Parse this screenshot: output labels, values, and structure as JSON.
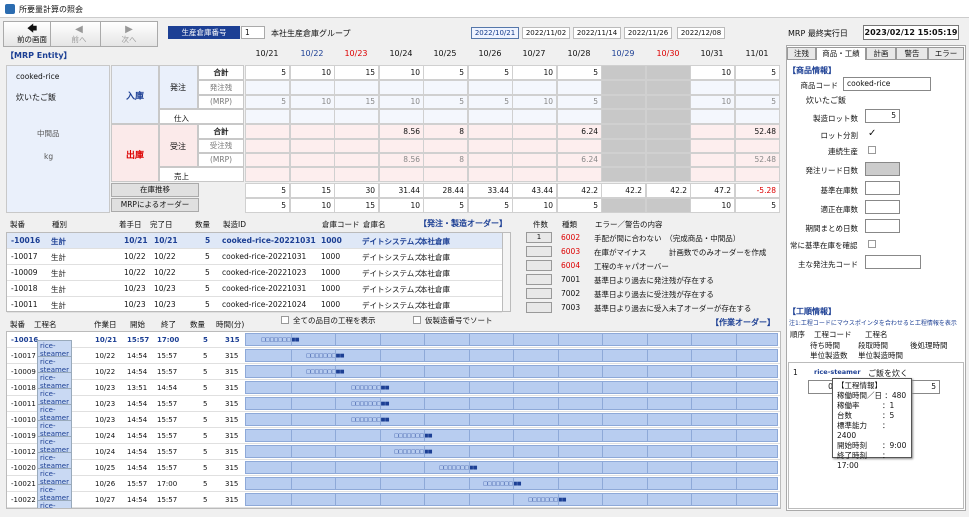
{
  "window": {
    "title": "所要量計算の照会"
  },
  "nav": {
    "prev_screen": "前の画面",
    "prev": "前へ",
    "next": "次へ"
  },
  "production": {
    "label": "生産倉庫番号",
    "value": "1",
    "name": "本社生産倉庫グループ"
  },
  "date_tabs": [
    "2022/10/21",
    "2022/11/02",
    "2022/11/14",
    "2022/11/26",
    "2022/12/08"
  ],
  "mrp": {
    "label": "MRP 最終実行日",
    "value": "2023/02/12 15:05:19"
  },
  "entity": {
    "title": "【MRP Entity】",
    "item_code": "cooked-rice",
    "item_name": "炊いたご飯",
    "category": "中間品",
    "unit": "kg"
  },
  "grid_dates": [
    {
      "d": "10/21",
      "c": "k"
    },
    {
      "d": "10/22",
      "c": "b"
    },
    {
      "d": "10/23",
      "c": "r"
    },
    {
      "d": "10/24",
      "c": "k"
    },
    {
      "d": "10/25",
      "c": "k"
    },
    {
      "d": "10/26",
      "c": "k"
    },
    {
      "d": "10/27",
      "c": "k"
    },
    {
      "d": "10/28",
      "c": "k"
    },
    {
      "d": "10/29",
      "c": "b"
    },
    {
      "d": "10/30",
      "c": "r"
    },
    {
      "d": "10/31",
      "c": "k"
    },
    {
      "d": "11/01",
      "c": "k"
    }
  ],
  "labels": {
    "nyuko": "入庫",
    "hatchu": "発注",
    "shiire": "仕入",
    "shukko": "出庫",
    "juchu": "受注",
    "uriage": "売上",
    "total": "合計",
    "hatchu_zan": "発注残",
    "juchu_zan": "受注残",
    "mrp": "(MRP)",
    "zaiko": "在庫推移",
    "mrp_order": "MRPによるオーダー"
  },
  "rows": {
    "in_total": [
      "5",
      "10",
      "15",
      "10",
      "5",
      "5",
      "10",
      "5",
      "",
      "",
      "10",
      "5"
    ],
    "in_mrp": [
      "5",
      "10",
      "15",
      "10",
      "5",
      "5",
      "10",
      "5",
      "",
      "",
      "10",
      "5"
    ],
    "out_total": [
      "",
      "",
      "",
      "8.56",
      "8",
      "",
      "",
      "6.24",
      "",
      "",
      "",
      "52.48"
    ],
    "out_mrp": [
      "",
      "",
      "",
      "8.56",
      "8",
      "",
      "",
      "6.24",
      "",
      "",
      "",
      "52.48"
    ],
    "zaiko": [
      "5",
      "15",
      "30",
      "31.44",
      "28.44",
      "33.44",
      "43.44",
      "42.2",
      "42.2",
      "42.2",
      "47.2",
      "-5.28"
    ],
    "mrp_order": [
      "5",
      "10",
      "15",
      "10",
      "5",
      "5",
      "10",
      "5",
      "",
      "",
      "10",
      "5"
    ]
  },
  "orders": {
    "headers": [
      "製番",
      "種別",
      "着手日",
      "完了日",
      "数量",
      "製造ID",
      "倉庫コード",
      "倉庫名"
    ],
    "title": "【発注・製造オーダー】",
    "rows": [
      [
        "-10016",
        "生計",
        "10/21",
        "10/21",
        "5",
        "cooked-rice-20221031",
        "1000",
        "デイトシステムズ",
        "本社倉庫"
      ],
      [
        "-10017",
        "生計",
        "10/22",
        "10/22",
        "5",
        "cooked-rice-20221031",
        "1000",
        "デイトシステムズ",
        "本社倉庫"
      ],
      [
        "-10009",
        "生計",
        "10/22",
        "10/22",
        "5",
        "cooked-rice-20221023",
        "1000",
        "デイトシステムズ",
        "本社倉庫"
      ],
      [
        "-10018",
        "生計",
        "10/23",
        "10/23",
        "5",
        "cooked-rice-20221031",
        "1000",
        "デイトシステムズ",
        "本社倉庫"
      ],
      [
        "-10011",
        "生計",
        "10/23",
        "10/23",
        "5",
        "cooked-rice-20221024",
        "1000",
        "デイトシステムズ",
        "本社倉庫"
      ]
    ]
  },
  "errors": {
    "headers": [
      "件数",
      "種類",
      "エラー／警告の内容"
    ],
    "rows": [
      {
        "count": "1",
        "code": "6002",
        "msg": "手配が間に合わない　（完成商品・中間品）",
        "red": true
      },
      {
        "count": "",
        "code": "6003",
        "msg": "在庫がマイナス　　　計画数でのみオーダーを作成",
        "red": true
      },
      {
        "count": "",
        "code": "6004",
        "msg": "工程のキャパオーバー",
        "red": true
      },
      {
        "count": "",
        "code": "7001",
        "msg": "基準日より過去に発注残が存在する",
        "red": false
      },
      {
        "count": "",
        "code": "7002",
        "msg": "基準日より過去に受注残が存在する",
        "red": false
      },
      {
        "count": "",
        "code": "7003",
        "msg": "基準日より過去に受入未了オーダーが存在する",
        "red": false
      }
    ]
  },
  "checks": {
    "all_process": "全ての品目の工程を表示",
    "temp_sort": "仮製造番号でソート"
  },
  "process": {
    "headers": [
      "製番",
      "工程名",
      "作業日",
      "開始",
      "終了",
      "数量",
      "時間(分)"
    ],
    "title": "【作業オーダー】",
    "rows": [
      [
        "-10016",
        "rice-steamer",
        "10/21",
        "15:57",
        "17:00",
        "5",
        "315"
      ],
      [
        "-10017",
        "rice-steamer",
        "10/22",
        "14:54",
        "15:57",
        "5",
        "315"
      ],
      [
        "-10009",
        "rice-steamer",
        "10/22",
        "14:54",
        "15:57",
        "5",
        "315"
      ],
      [
        "-10018",
        "rice-steamer",
        "10/23",
        "13:51",
        "14:54",
        "5",
        "315"
      ],
      [
        "-10011",
        "rice-steamer",
        "10/23",
        "14:54",
        "15:57",
        "5",
        "315"
      ],
      [
        "-10010",
        "rice-steamer",
        "10/23",
        "14:54",
        "15:57",
        "5",
        "315"
      ],
      [
        "-10019",
        "rice-steamer",
        "10/24",
        "14:54",
        "15:57",
        "5",
        "315"
      ],
      [
        "-10012",
        "rice-steamer",
        "10/24",
        "14:54",
        "15:57",
        "5",
        "315"
      ],
      [
        "-10020",
        "rice-steamer",
        "10/25",
        "14:54",
        "15:57",
        "5",
        "315"
      ],
      [
        "-10021",
        "rice-steamer",
        "10/26",
        "15:57",
        "17:00",
        "5",
        "315"
      ],
      [
        "-10022",
        "rice-steamer",
        "10/27",
        "14:54",
        "15:57",
        "5",
        "315"
      ]
    ]
  },
  "right_tabs": [
    "注残",
    "商品・工績",
    "計画",
    "警告",
    "エラー"
  ],
  "item_info": {
    "title": "【商品情報】",
    "code_label": "商品コード",
    "code": "cooked-rice",
    "name": "炊いたご飯",
    "lot_label": "製造ロット数",
    "lot": "5",
    "split_label": "ロット分割",
    "cont_label": "連続生産",
    "lead_label": "発注リード日数",
    "base_label": "基準在庫数",
    "proper_label": "適正在庫数",
    "period_label": "期間まとめ日数",
    "always_label": "常に基準在庫を確認",
    "supplier_label": "主な発注先コード"
  },
  "proc_info": {
    "title": "【工順情報】",
    "note": "注1:工程コードにマウスポインタを合わせると工程情報を表示",
    "h1": "順序",
    "h2": "工程コード",
    "h3": "工程名",
    "h4": "待ち時間",
    "h5": "段取時間",
    "h6": "後処理時間",
    "h7": "単位製造数",
    "h8": "単位製造時間",
    "seq": "1",
    "code": "rice-steamer",
    "name": "ご飯を炊く",
    "v1": "0",
    "v2": "5"
  },
  "tooltip": {
    "title": "【工程情報】",
    "lines": [
      "稼働時間／日 ：480",
      "稼働率　　　：1",
      "台数　　　　：5",
      "標準能力　　：2400",
      "開始時刻　　：9:00",
      "終了時刻　　：17:00"
    ]
  }
}
